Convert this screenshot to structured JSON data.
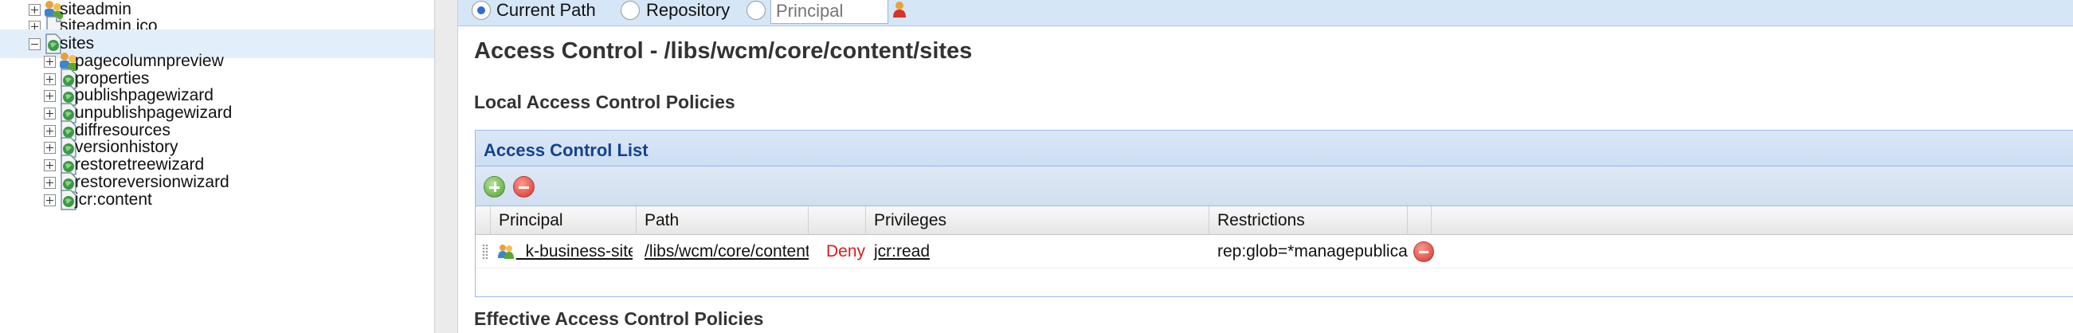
{
  "tree": {
    "nodes": [
      {
        "label": "siteadmin",
        "expander": "plus",
        "icon": "group-folder-icon"
      },
      {
        "label": "siteadmin.ico",
        "expander": "plus",
        "icon": "file-icon"
      },
      {
        "label": "sites",
        "expander": "minus",
        "icon": "globe-page-icon",
        "selected": true
      },
      {
        "label": "pagecolumnpreview",
        "expander": "plus",
        "icon": "group-folder-icon"
      },
      {
        "label": "properties",
        "expander": "plus",
        "icon": "globe-page-icon"
      },
      {
        "label": "publishpagewizard",
        "expander": "plus",
        "icon": "globe-page-icon"
      },
      {
        "label": "unpublishpagewizard",
        "expander": "plus",
        "icon": "globe-page-icon"
      },
      {
        "label": "diffresources",
        "expander": "plus",
        "icon": "globe-page-icon"
      },
      {
        "label": "versionhistory",
        "expander": "plus",
        "icon": "globe-page-icon"
      },
      {
        "label": "restoretreewizard",
        "expander": "plus",
        "icon": "globe-page-icon"
      },
      {
        "label": "restoreversionwizard",
        "expander": "plus",
        "icon": "globe-page-icon"
      },
      {
        "label": "jcr:content",
        "expander": "plus",
        "icon": "globe-page-icon"
      }
    ]
  },
  "scope": {
    "current_path": "Current Path",
    "repository": "Repository",
    "principal_placeholder": "Principal",
    "selected": "current_path"
  },
  "main": {
    "title": "Access Control - /libs/wcm/core/content/sites",
    "local_policies": "Local Access Control Policies",
    "effective_policies": "Effective Access Control Policies"
  },
  "acl": {
    "title": "Access Control List",
    "columns": {
      "principal": "Principal",
      "path": "Path",
      "action": "",
      "privileges": "Privileges",
      "restrictions": "Restrictions"
    },
    "rows": [
      {
        "principal": "_k-business-sites-cms…",
        "path": "/libs/wcm/core/content/sites",
        "action": "Deny",
        "privileges": "jcr:read",
        "restrictions": "rep:glob=*managepublicationwizard"
      }
    ]
  },
  "colors": {
    "selection": "#e3eefb",
    "header_blue": "#15428b",
    "deny_red": "#d11f1f",
    "topbar": "#d5e6f7"
  }
}
